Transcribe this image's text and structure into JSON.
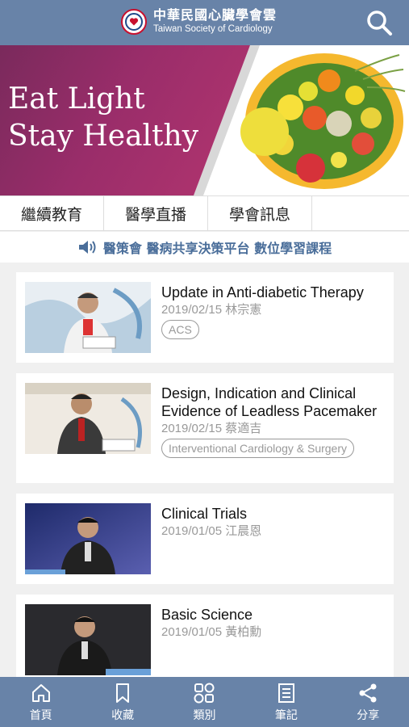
{
  "header": {
    "brand_zh": "中華民國心臟學會雲",
    "brand_en": "Taiwan Society of Cardiology"
  },
  "banner": {
    "line1": "Eat Light",
    "line2": "Stay Healthy"
  },
  "tabs": [
    {
      "label": "繼續教育"
    },
    {
      "label": "醫學直播"
    },
    {
      "label": "學會訊息"
    }
  ],
  "notice": {
    "text": "醫策會 醫病共享決策平台 數位學習課程"
  },
  "videos": [
    {
      "title": "Update in Anti-diabetic Therapy",
      "meta": "2019/02/15 林宗憲",
      "tag": "ACS"
    },
    {
      "title": "Design, Indication and Clinical Evidence of Leadless Pacemaker",
      "meta": "2019/02/15 蔡適吉",
      "tag": "Interventional Cardiology & Surgery"
    },
    {
      "title": "Clinical Trials",
      "meta": "2019/01/05 江晨恩",
      "tag": ""
    },
    {
      "title": "Basic Science",
      "meta": "2019/01/05 黃柏勳",
      "tag": ""
    }
  ],
  "bottom_nav": [
    {
      "label": "首頁",
      "icon": "home-icon"
    },
    {
      "label": "收藏",
      "icon": "bookmark-icon"
    },
    {
      "label": "類別",
      "icon": "grid-icon"
    },
    {
      "label": "筆記",
      "icon": "notes-icon"
    },
    {
      "label": "分享",
      "icon": "share-icon"
    }
  ],
  "colors": {
    "header_bg": "#6883a8",
    "banner_purple": "#9a2d6a",
    "notice_blue": "#4a6e9a"
  }
}
